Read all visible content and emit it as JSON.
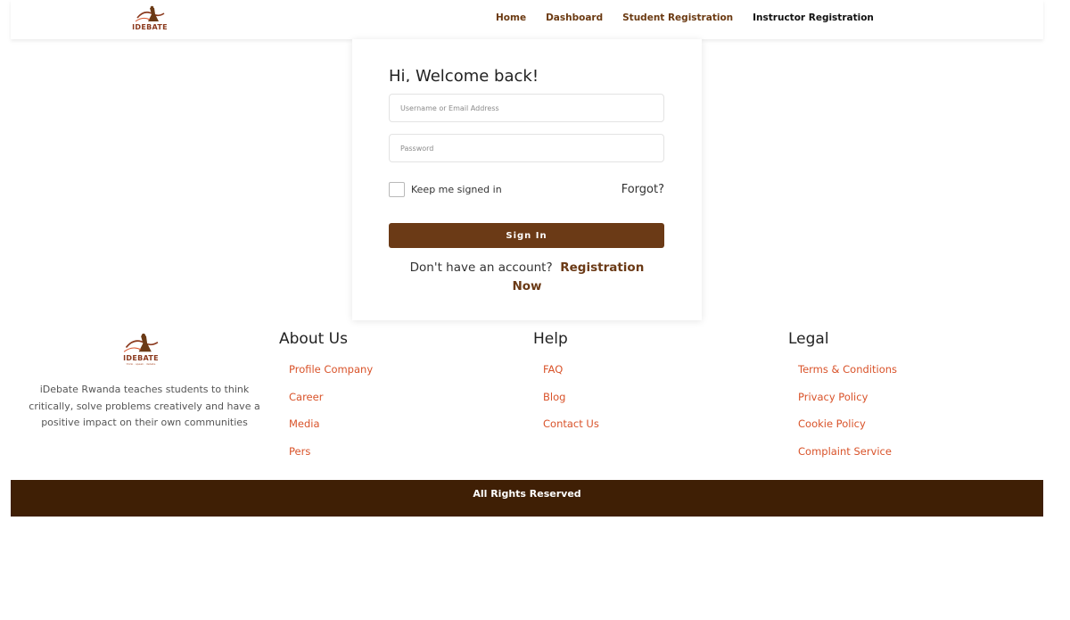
{
  "brand": {
    "logo_text": "IDEBATE",
    "logo_tagline": "think · speak · debate",
    "colors": {
      "primary": "#6b3a16",
      "footer_bar": "#3f1f05",
      "link_accent": "#d9532a"
    }
  },
  "nav": {
    "logo_icon": "idebate-logo-icon",
    "items": [
      {
        "label": "Home"
      },
      {
        "label": "Dashboard"
      },
      {
        "label": "Student Registration"
      },
      {
        "label": "Instructor Registration"
      }
    ]
  },
  "login": {
    "title": "Hi, Welcome back!",
    "username_placeholder": "Username or Email Address",
    "password_placeholder": "Password",
    "remember_label": "Keep me signed in",
    "forgot_label": "Forgot?",
    "signin_label": "Sign In",
    "no_account_text": "Don't have an account?",
    "register_label": "Registration Now"
  },
  "footer": {
    "about_text": "iDebate Rwanda teaches students to think critically, solve problems creatively and have a positive impact on their own communities",
    "columns": [
      {
        "title": "About Us",
        "items": [
          "Profile Company",
          "Career",
          "Media",
          "Pers"
        ]
      },
      {
        "title": "Help",
        "items": [
          "FAQ",
          "Blog",
          "Contact Us"
        ]
      },
      {
        "title": "Legal",
        "items": [
          "Terms & Conditions",
          "Privacy Policy",
          "Cookie Policy",
          "Complaint Service"
        ]
      }
    ],
    "copyright": "All Rights Reserved"
  }
}
